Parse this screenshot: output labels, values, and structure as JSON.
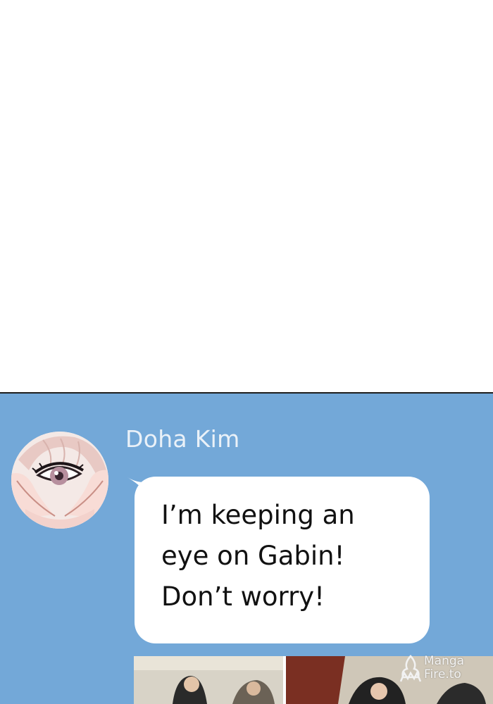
{
  "message": {
    "sender": "Doha Kim",
    "text": "I’m keeping an\neye on Gabin!\nDon’t worry!"
  },
  "watermark": {
    "line1": "Manga",
    "line2": "Fire.to"
  },
  "colors": {
    "panel_background": "#73a8d8",
    "bubble": "#ffffff",
    "sender_name": "#eaf1f8"
  },
  "icons": {
    "avatar": "eye-heart-hands-avatar",
    "watermark_logo": "mangafire-logo"
  }
}
